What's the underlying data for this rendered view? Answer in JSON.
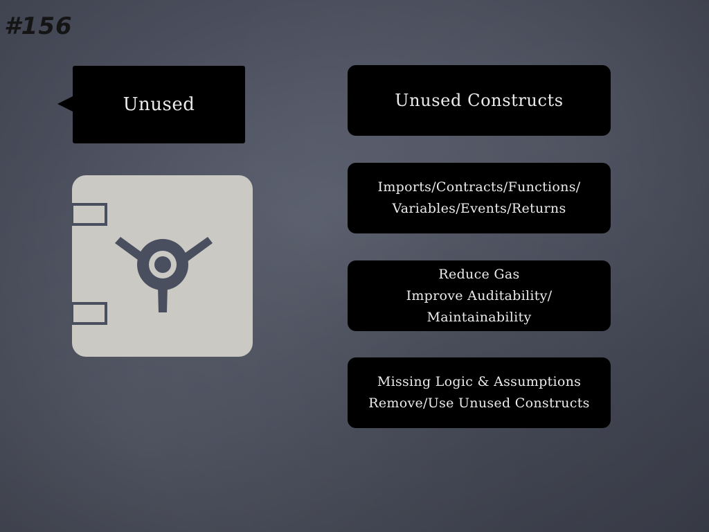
{
  "slide_number": "#156",
  "callout": {
    "label": "Unused"
  },
  "icons": {
    "safe": "safe-vault-icon"
  },
  "boxes": [
    {
      "lines": [
        "Unused Constructs"
      ]
    },
    {
      "lines": [
        "Imports/Contracts/Functions/",
        "Variables/Events/Returns"
      ]
    },
    {
      "lines": [
        "Reduce Gas",
        "Improve Auditability/",
        "Maintainability"
      ]
    },
    {
      "lines": [
        "Missing Logic & Assumptions",
        "Remove/Use Unused Constructs"
      ]
    }
  ],
  "colors": {
    "background": "#4b4f5d",
    "box": "#000000",
    "text": "#ececec",
    "safe": "#cbc9c4",
    "safe_detail": "#4a4f60"
  }
}
